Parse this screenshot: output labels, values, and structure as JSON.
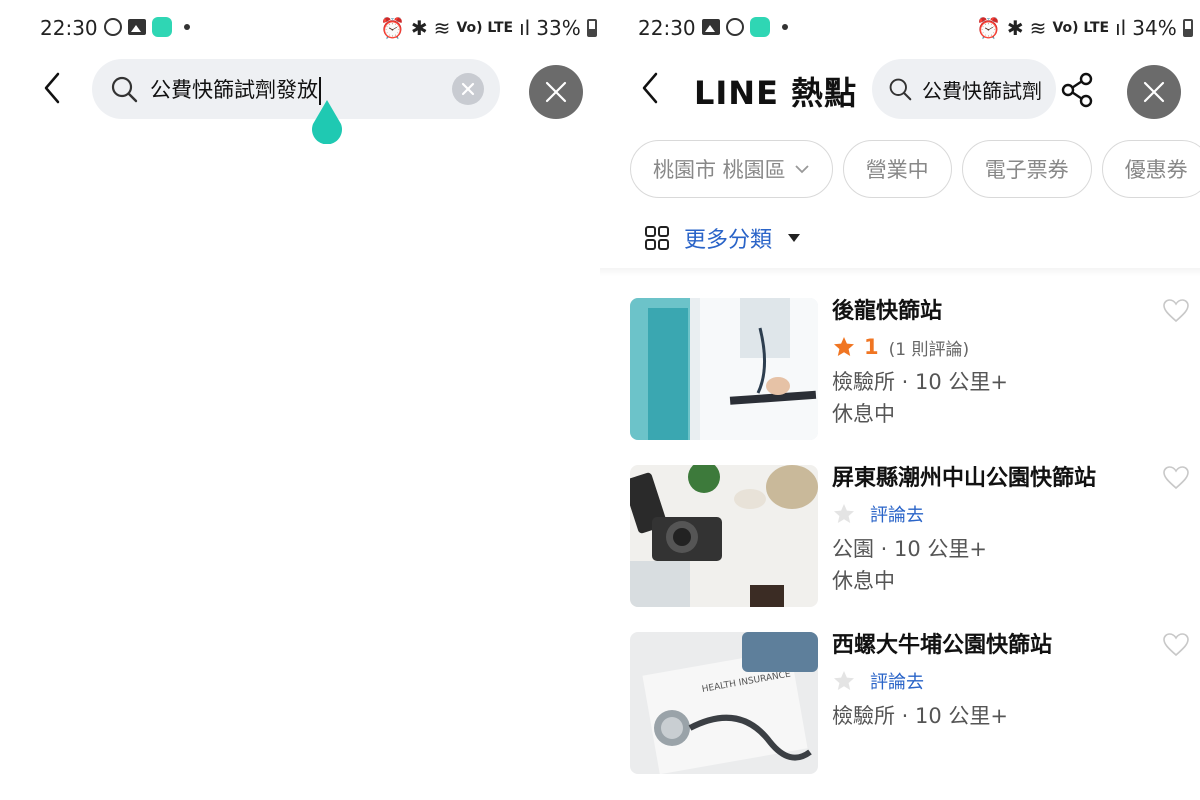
{
  "left": {
    "status": {
      "time": "22:30",
      "network_label": "Vo) LTE",
      "battery": "33%"
    },
    "search": {
      "query": "公費快篩試劑發放"
    }
  },
  "right": {
    "status": {
      "time": "22:30",
      "network_label": "Vo) LTE",
      "battery": "34%"
    },
    "header": {
      "title": "LINE 熱點",
      "search_query": "公費快篩試劑"
    },
    "filters": {
      "location": "桃園市 桃園區",
      "chips": [
        "營業中",
        "電子票券",
        "優惠券"
      ]
    },
    "more_categories": "更多分類",
    "results": [
      {
        "name": "後龍快篩站",
        "rating": "1",
        "review_count": "(1 則評論)",
        "meta": "檢驗所 · 10 公里+",
        "status": "休息中",
        "thumb": "medical-staff"
      },
      {
        "name": "屏東縣潮州中山公園快篩站",
        "review_link": "評論去",
        "meta": "公園 · 10 公里+",
        "status": "休息中",
        "thumb": "desk-camera"
      },
      {
        "name": "西螺大牛埔公園快篩站",
        "review_link": "評論去",
        "meta": "檢驗所 · 10 公里+",
        "thumb": "stethoscope-insurance",
        "thumb_text": "HEALTH INSURANCE"
      }
    ]
  },
  "colors": {
    "accent_blue": "#2a64c8",
    "rating_orange": "#f07522",
    "teal_app": "#2fd6b4",
    "close_gray": "#6b6b6b"
  }
}
